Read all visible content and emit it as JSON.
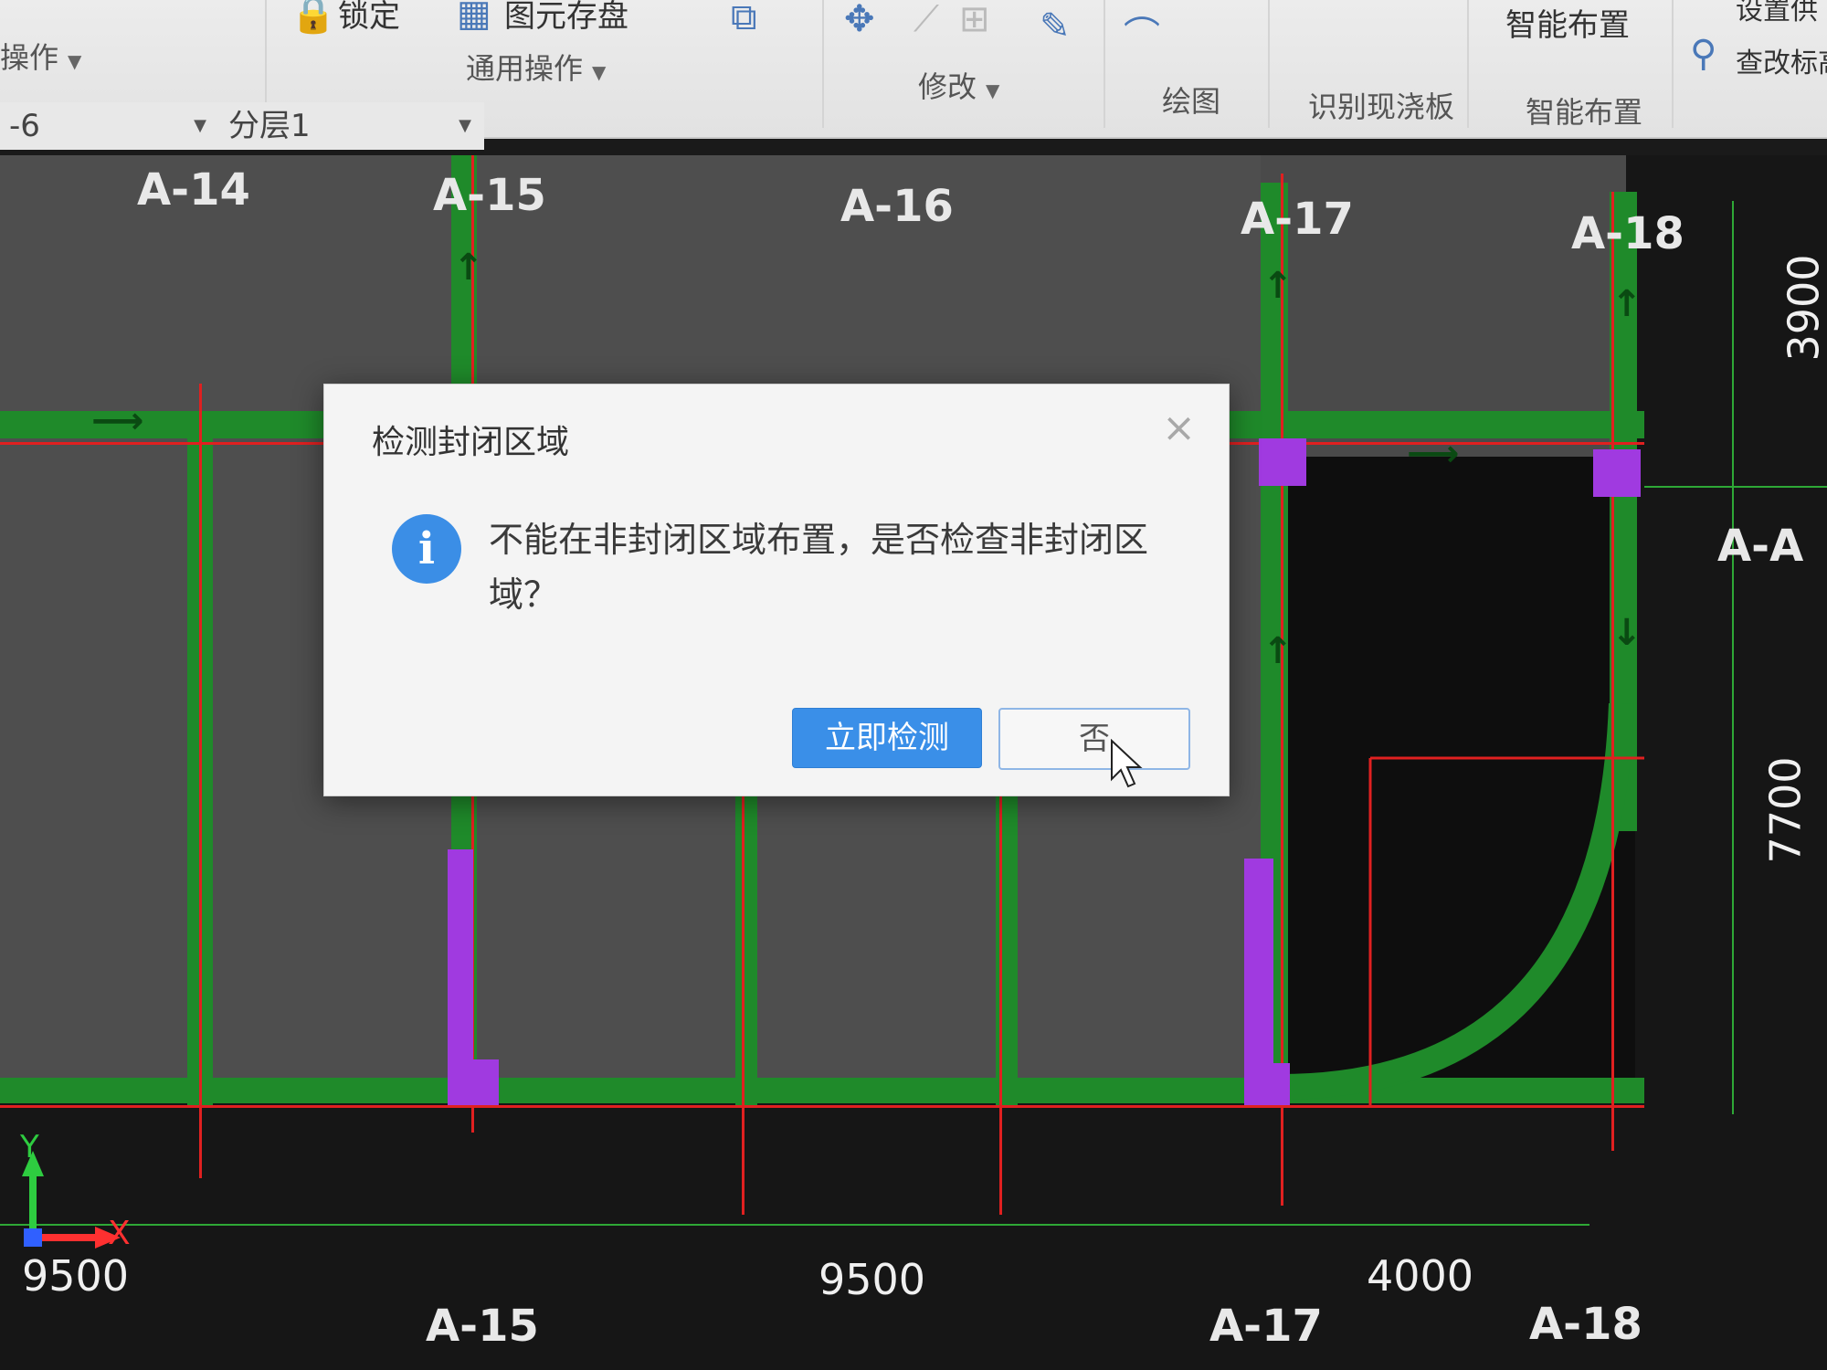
{
  "ribbon": {
    "top_items": [
      {
        "icon": "lock-icon",
        "label": "锁定"
      },
      {
        "icon": "storage-icon",
        "label": "图元存盘"
      }
    ],
    "groups": {
      "operate": "操作",
      "general": "通用操作",
      "modify": "修改",
      "draw": "绘图",
      "recognize_slab": "识别现浇板",
      "smart_layout": "智能布置"
    },
    "smart_layout_top": "智能布置",
    "set_supply": "设置供",
    "check_mark": "查改标高"
  },
  "selectors": {
    "floor": "-6",
    "layer": "分层1"
  },
  "axes": {
    "top": [
      "A-14",
      "A-15",
      "A-16",
      "A-17",
      "A-18"
    ],
    "bottom": [
      "A-15",
      "A-17",
      "A-18"
    ],
    "right": "A-A"
  },
  "dimensions": {
    "bottom": [
      "9500",
      "9500",
      "4000"
    ],
    "right": [
      "3900",
      "7700"
    ]
  },
  "coordinate_icon": {
    "x": "X",
    "y": "Y"
  },
  "dialog": {
    "title": "检测封闭区域",
    "message": "不能在非封闭区域布置，是否检查非封闭区域？",
    "confirm_label": "立即检测",
    "cancel_label": "否"
  }
}
